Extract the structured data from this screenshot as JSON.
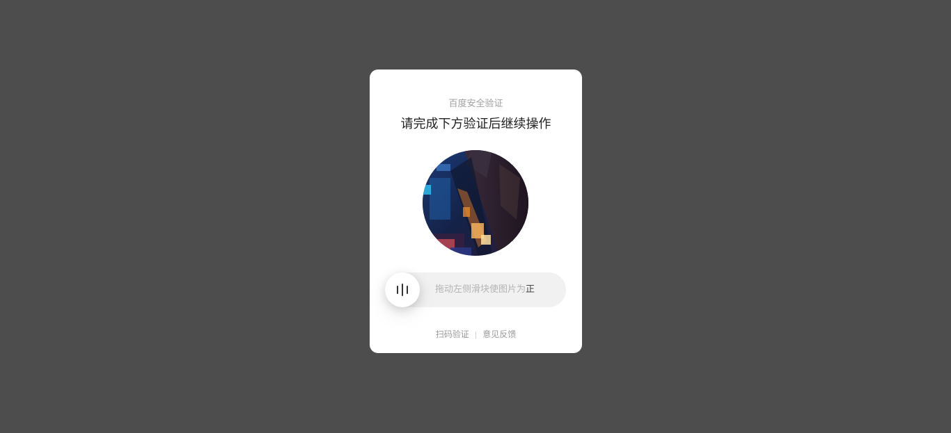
{
  "dialog": {
    "brand": "百度安全验证",
    "headline": "请完成下方验证后继续操作"
  },
  "slider": {
    "hint_light": "拖动左侧滑块使图片为",
    "hint_dark": "正",
    "handle_icon": "grip-bars-icon"
  },
  "footer": {
    "scan_link": "扫码验证",
    "separator": "|",
    "feedback_link": "意见反馈"
  },
  "colors": {
    "backdrop": "#4d4d4d",
    "card": "#ffffff",
    "track": "#f1f1f1"
  }
}
